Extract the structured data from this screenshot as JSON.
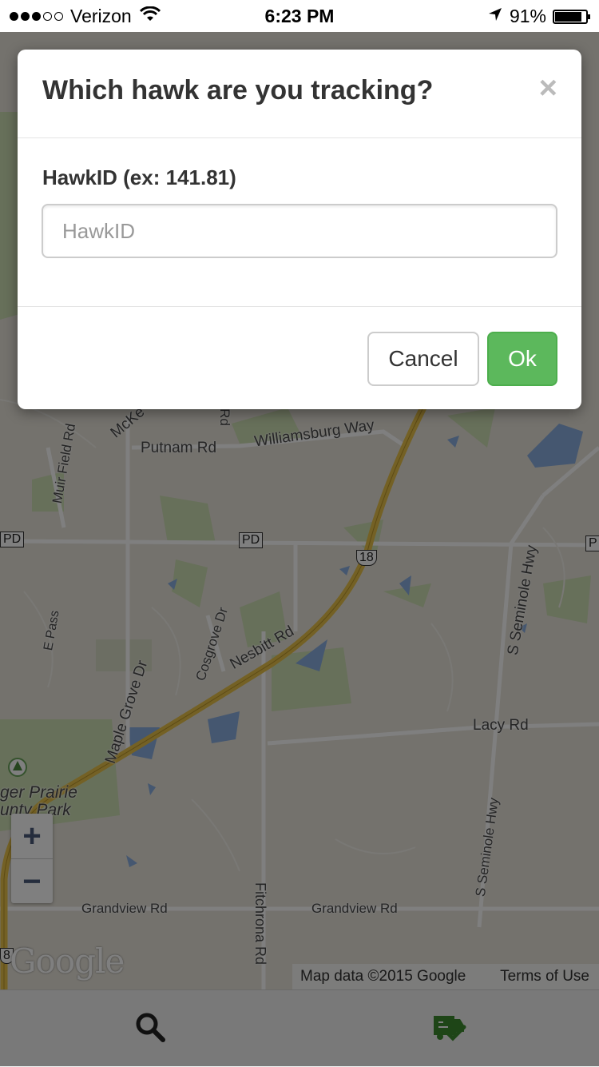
{
  "status_bar": {
    "carrier": "Verizon",
    "signal_bars": 3,
    "signal_max": 5,
    "time": "6:23 PM",
    "battery": "91%",
    "battery_level": 0.91
  },
  "map": {
    "road_labels": [
      "Putnam Rd",
      "Williamsburg Way",
      "Muir Field Rd",
      "E Pass",
      "Cosgrove Dr",
      "Nesbitt Rd",
      "Maple Grove Dr",
      "S Seminole Hwy",
      "Lacy Rd",
      "Grandview Rd",
      "Fitchrona Rd",
      "McKe",
      "Rd"
    ],
    "park_label_1": "ger Prairie",
    "park_label_2": "unty Park",
    "shields": [
      "PD",
      "PD",
      "18",
      "P",
      "8"
    ],
    "zoom_in": "+",
    "zoom_out": "−",
    "logo": "Google",
    "attribution": "Map data ©2015 Google",
    "terms": "Terms of Use"
  },
  "tabbar": {
    "search_icon": "search-icon",
    "track_icon": "truck-check-icon",
    "active_color": "#3c8a2e"
  },
  "modal": {
    "title": "Which hawk are you tracking?",
    "close": "×",
    "field_label": "HawkID (ex: 141.81)",
    "field_value": "",
    "field_placeholder": "HawkID",
    "cancel_label": "Cancel",
    "ok_label": "Ok",
    "ok_color": "#5cb85c"
  }
}
